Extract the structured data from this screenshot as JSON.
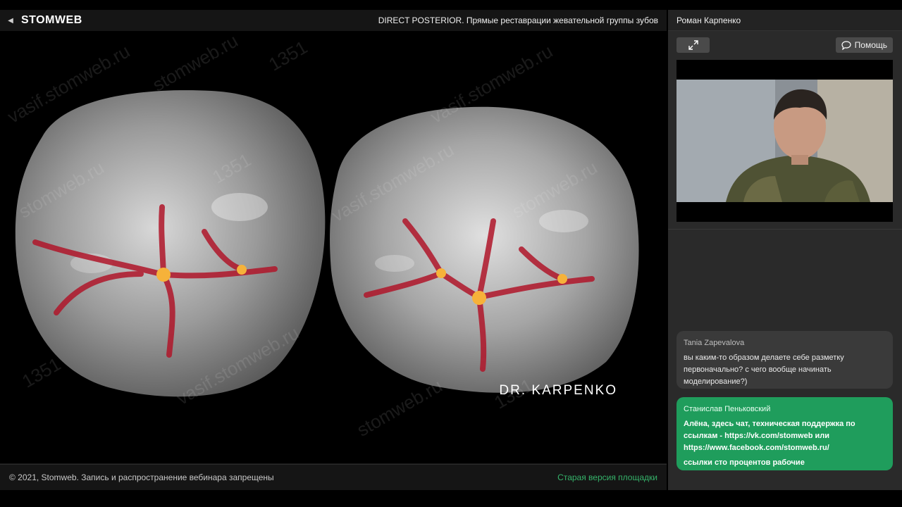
{
  "header": {
    "brand": "STOMWEB",
    "webinar_title": "DIRECT POSTERIOR. Прямые реставрации жевательной группы зубов"
  },
  "slide": {
    "signature": "DR. KARPENKO",
    "watermarks": [
      "vasif.stomweb.ru",
      "stomweb.ru",
      "1351",
      "vasif.stomweb.ru",
      "stomweb.ru",
      "1351",
      "vasif.stomweb.ru",
      "stomweb.ru",
      "1351",
      "vasif.stomweb.ru",
      "stomweb.ru",
      "1351"
    ]
  },
  "footer": {
    "copyright": "© 2021, Stomweb. Запись и распространение вебинара запрещены",
    "old_version": "Старая версия площадки"
  },
  "side": {
    "speaker_name": "Роман Карпенко",
    "help_label": "Помощь"
  },
  "chat": [
    {
      "author": "Tania Zapevalova",
      "text": "вы каким-то образом делаете себе разметку первоначально? с чего вообще начинать моделирование?)"
    },
    {
      "author": "Станислав Пеньковский",
      "text": "Алёна, здесь чат, техническая поддержка по ссылкам - https://vk.com/stomweb или https://www.facebook.com/stomweb.ru/",
      "text2": "ссылки сто процентов рабочие"
    }
  ],
  "colors": {
    "accent_green": "#1f9d5c",
    "link_green": "#35b36a",
    "marker_yellow": "#f6b23a",
    "fissure_red": "#b0162a"
  }
}
